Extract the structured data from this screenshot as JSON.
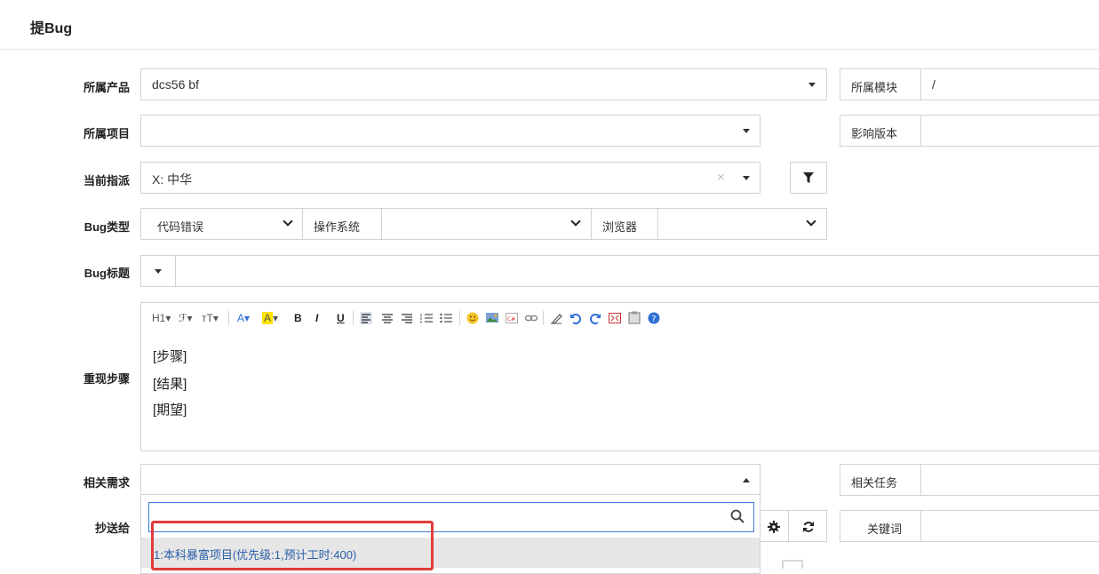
{
  "page": {
    "title": "提Bug"
  },
  "form": {
    "product": {
      "label": "所属产品",
      "value": "dcs56 bf"
    },
    "module": {
      "label": "所属模块",
      "value": "/"
    },
    "project": {
      "label": "所属项目",
      "value": ""
    },
    "affected_version": {
      "label": "影响版本"
    },
    "assigned_to": {
      "label": "当前指派",
      "value": "X: 中华",
      "clear": "×"
    },
    "bug_type": {
      "label": "Bug类型",
      "value": "代码错误"
    },
    "os": {
      "label": "操作系统",
      "value": ""
    },
    "browser": {
      "label": "浏览器",
      "value": ""
    },
    "bug_title": {
      "label": "Bug标题",
      "value": ""
    },
    "repro_steps": {
      "label": "重现步骤",
      "lines": [
        "[步骤]",
        "[结果]",
        "[期望]"
      ],
      "toolbar": {
        "heading": "H1",
        "font_family": "ℱ",
        "font_size": "тT",
        "font_color": "A",
        "bg_color": "A",
        "bold": "B",
        "italic": "I",
        "underline": "U"
      }
    },
    "related_story": {
      "label": "相关需求",
      "search_placeholder": "",
      "options": [
        "1:本科暴富项目(优先级:1,预计工时:400)"
      ]
    },
    "related_task": {
      "label": "相关任务"
    },
    "cc": {
      "label": "抄送给"
    },
    "keywords": {
      "label": "关键词"
    }
  },
  "colors": {
    "accent": "#3c7ad8",
    "highlight_border": "#e23b3b",
    "option_text": "#2b5fa8"
  },
  "icons": [
    "filter-icon",
    "chevron-down-icon",
    "caret-down-icon",
    "search-icon",
    "gear-icon",
    "refresh-icon",
    "emoji-icon",
    "image-icon",
    "link-icon",
    "undo-icon",
    "redo-icon",
    "help-icon"
  ]
}
